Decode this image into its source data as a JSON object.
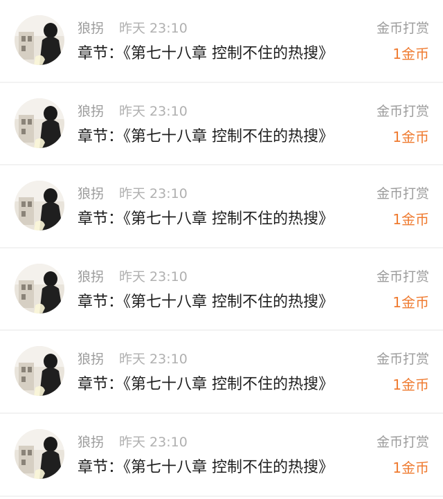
{
  "colors": {
    "meta_text": "#9c9c9c",
    "primary_text": "#1e1e1e",
    "accent_amount": "#ef7a2f",
    "divider": "#f2f2f2"
  },
  "records": [
    {
      "username": "狼拐",
      "time": "昨天 23:10",
      "type": "金币打赏",
      "chapter": "章节：《第七十八章 控制不住的热搜》",
      "amount": "1金币"
    },
    {
      "username": "狼拐",
      "time": "昨天 23:10",
      "type": "金币打赏",
      "chapter": "章节：《第七十八章 控制不住的热搜》",
      "amount": "1金币"
    },
    {
      "username": "狼拐",
      "time": "昨天 23:10",
      "type": "金币打赏",
      "chapter": "章节：《第七十八章 控制不住的热搜》",
      "amount": "1金币"
    },
    {
      "username": "狼拐",
      "time": "昨天 23:10",
      "type": "金币打赏",
      "chapter": "章节：《第七十八章 控制不住的热搜》",
      "amount": "1金币"
    },
    {
      "username": "狼拐",
      "time": "昨天 23:10",
      "type": "金币打赏",
      "chapter": "章节：《第七十八章 控制不住的热搜》",
      "amount": "1金币"
    },
    {
      "username": "狼拐",
      "time": "昨天 23:10",
      "type": "金币打赏",
      "chapter": "章节：《第七十八章 控制不住的热搜》",
      "amount": "1金币"
    }
  ]
}
